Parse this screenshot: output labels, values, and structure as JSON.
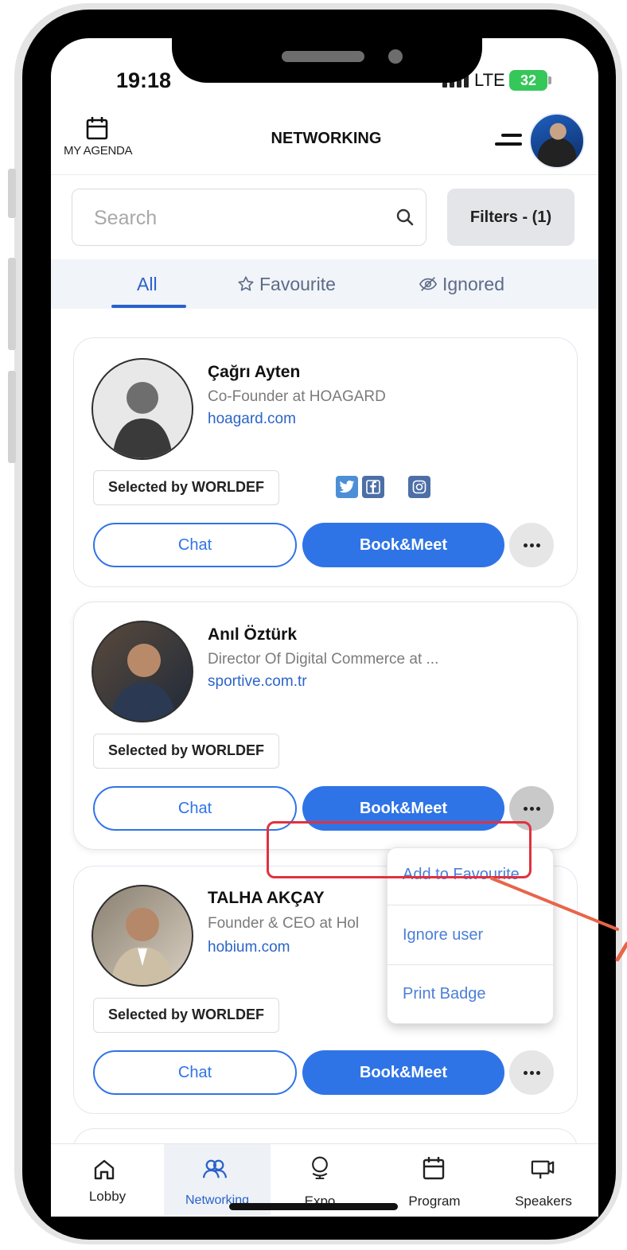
{
  "status_bar": {
    "time": "19:18",
    "network": "LTE",
    "battery": "32"
  },
  "header": {
    "agenda_label": "MY AGENDA",
    "title": "NETWORKING"
  },
  "search": {
    "placeholder": "Search",
    "filters_label": "Filters - (1)"
  },
  "tabs": [
    {
      "label": "All",
      "icon": "list",
      "active": true
    },
    {
      "label": "Favourite",
      "icon": "star-outline-icon",
      "active": false
    },
    {
      "label": "Ignored",
      "icon": "eye-off-icon",
      "active": false
    }
  ],
  "cards": [
    {
      "name": "Çağrı Ayten",
      "role": "Co-Founder at HOAGARD",
      "website": "hoagard.com",
      "badge": "Selected by WORLDEF",
      "social": [
        "twitter-icon",
        "facebook-icon",
        "instagram-icon"
      ],
      "chat_label": "Chat",
      "book_label": "Book&Meet"
    },
    {
      "name": "Anıl Öztürk",
      "role": "Director Of Digital Commerce at ...",
      "website": "sportive.com.tr",
      "badge": "Selected by WORLDEF",
      "chat_label": "Chat",
      "book_label": "Book&Meet"
    },
    {
      "name": "TALHA AKÇAY",
      "role": "Founder & CEO at Hol",
      "website": "hobium.com",
      "badge": "Selected by WORLDEF",
      "chat_label": "Chat",
      "book_label": "Book&Meet"
    }
  ],
  "more_menu": {
    "items": [
      "Add to Favourite",
      "Ignore user",
      "Print Badge"
    ]
  },
  "bottom_nav": [
    {
      "label": "Lobby",
      "icon": "home-icon",
      "active": false
    },
    {
      "label": "Networking",
      "icon": "people-icon",
      "active": true
    },
    {
      "label": "Expo",
      "icon": "globe-icon",
      "active": false
    },
    {
      "label": "Program",
      "icon": "calendar-icon",
      "active": false
    },
    {
      "label": "Speakers",
      "icon": "presentation-icon",
      "active": false
    }
  ],
  "colors": {
    "primary": "#2f74e6",
    "accent_text": "#2a62c9",
    "highlight": "#e0323f",
    "arrow": "#e8654a"
  }
}
